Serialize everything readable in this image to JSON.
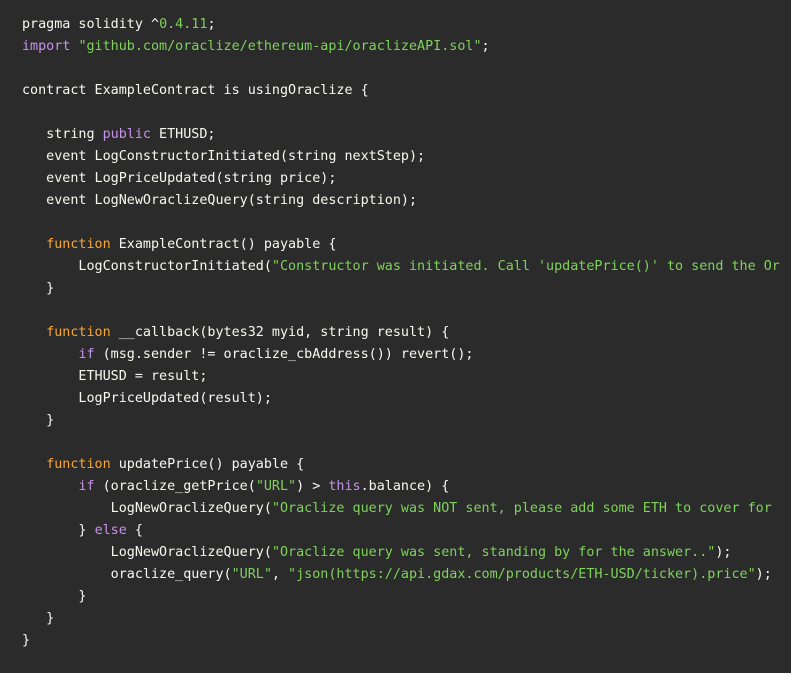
{
  "editor": {
    "language": "solidity",
    "background_color": "#2b2b2b",
    "colors": {
      "plain": "#f8f8f2",
      "keyword": "#c792ea",
      "function": "#f9a534",
      "string": "#7ed35a"
    },
    "lines": [
      [
        {
          "t": "pragma solidity ^",
          "c": "plain"
        },
        {
          "t": "0.4.11",
          "c": "number"
        },
        {
          "t": ";",
          "c": "plain"
        }
      ],
      [
        {
          "t": "import",
          "c": "keyword"
        },
        {
          "t": " ",
          "c": "plain"
        },
        {
          "t": "\"github.com/oraclize/ethereum-api/oraclizeAPI.sol\"",
          "c": "string"
        },
        {
          "t": ";",
          "c": "plain"
        }
      ],
      [],
      [
        {
          "t": "contract ExampleContract is usingOraclize {",
          "c": "plain"
        }
      ],
      [],
      [
        {
          "t": "   string ",
          "c": "plain"
        },
        {
          "t": "public",
          "c": "keyword"
        },
        {
          "t": " ETHUSD;",
          "c": "plain"
        }
      ],
      [
        {
          "t": "   event LogConstructorInitiated(string nextStep);",
          "c": "plain"
        }
      ],
      [
        {
          "t": "   event LogPriceUpdated(string price);",
          "c": "plain"
        }
      ],
      [
        {
          "t": "   event LogNewOraclizeQuery(string description);",
          "c": "plain"
        }
      ],
      [],
      [
        {
          "t": "   ",
          "c": "plain"
        },
        {
          "t": "function",
          "c": "function"
        },
        {
          "t": " ExampleContract() payable {",
          "c": "plain"
        }
      ],
      [
        {
          "t": "       LogConstructorInitiated(",
          "c": "plain"
        },
        {
          "t": "\"Constructor was initiated. Call 'updatePrice()' to send the Or",
          "c": "string"
        }
      ],
      [
        {
          "t": "   }",
          "c": "plain"
        }
      ],
      [],
      [
        {
          "t": "   ",
          "c": "plain"
        },
        {
          "t": "function",
          "c": "function"
        },
        {
          "t": " __callback(bytes32 myid, string result) {",
          "c": "plain"
        }
      ],
      [
        {
          "t": "       ",
          "c": "plain"
        },
        {
          "t": "if",
          "c": "keyword"
        },
        {
          "t": " (msg.sender != oraclize_cbAddress()) revert();",
          "c": "plain"
        }
      ],
      [
        {
          "t": "       ETHUSD = result;",
          "c": "plain"
        }
      ],
      [
        {
          "t": "       LogPriceUpdated(result);",
          "c": "plain"
        }
      ],
      [
        {
          "t": "   }",
          "c": "plain"
        }
      ],
      [],
      [
        {
          "t": "   ",
          "c": "plain"
        },
        {
          "t": "function",
          "c": "function"
        },
        {
          "t": " updatePrice() payable {",
          "c": "plain"
        }
      ],
      [
        {
          "t": "       ",
          "c": "plain"
        },
        {
          "t": "if",
          "c": "keyword"
        },
        {
          "t": " (oraclize_getPrice(",
          "c": "plain"
        },
        {
          "t": "\"URL\"",
          "c": "string"
        },
        {
          "t": ") > ",
          "c": "plain"
        },
        {
          "t": "this",
          "c": "keyword"
        },
        {
          "t": ".balance) {",
          "c": "plain"
        }
      ],
      [
        {
          "t": "           LogNewOraclizeQuery(",
          "c": "plain"
        },
        {
          "t": "\"Oraclize query was NOT sent, please add some ETH to cover for",
          "c": "string"
        }
      ],
      [
        {
          "t": "       } ",
          "c": "plain"
        },
        {
          "t": "else",
          "c": "keyword"
        },
        {
          "t": " {",
          "c": "plain"
        }
      ],
      [
        {
          "t": "           LogNewOraclizeQuery(",
          "c": "plain"
        },
        {
          "t": "\"Oraclize query was sent, standing by for the answer..\"",
          "c": "string"
        },
        {
          "t": ");",
          "c": "plain"
        }
      ],
      [
        {
          "t": "           oraclize_query(",
          "c": "plain"
        },
        {
          "t": "\"URL\"",
          "c": "string"
        },
        {
          "t": ", ",
          "c": "plain"
        },
        {
          "t": "\"json(https://api.gdax.com/products/ETH-USD/ticker).price\"",
          "c": "string"
        },
        {
          "t": ");",
          "c": "plain"
        }
      ],
      [
        {
          "t": "       }",
          "c": "plain"
        }
      ],
      [
        {
          "t": "   }",
          "c": "plain"
        }
      ],
      [
        {
          "t": "}",
          "c": "plain"
        }
      ]
    ]
  }
}
